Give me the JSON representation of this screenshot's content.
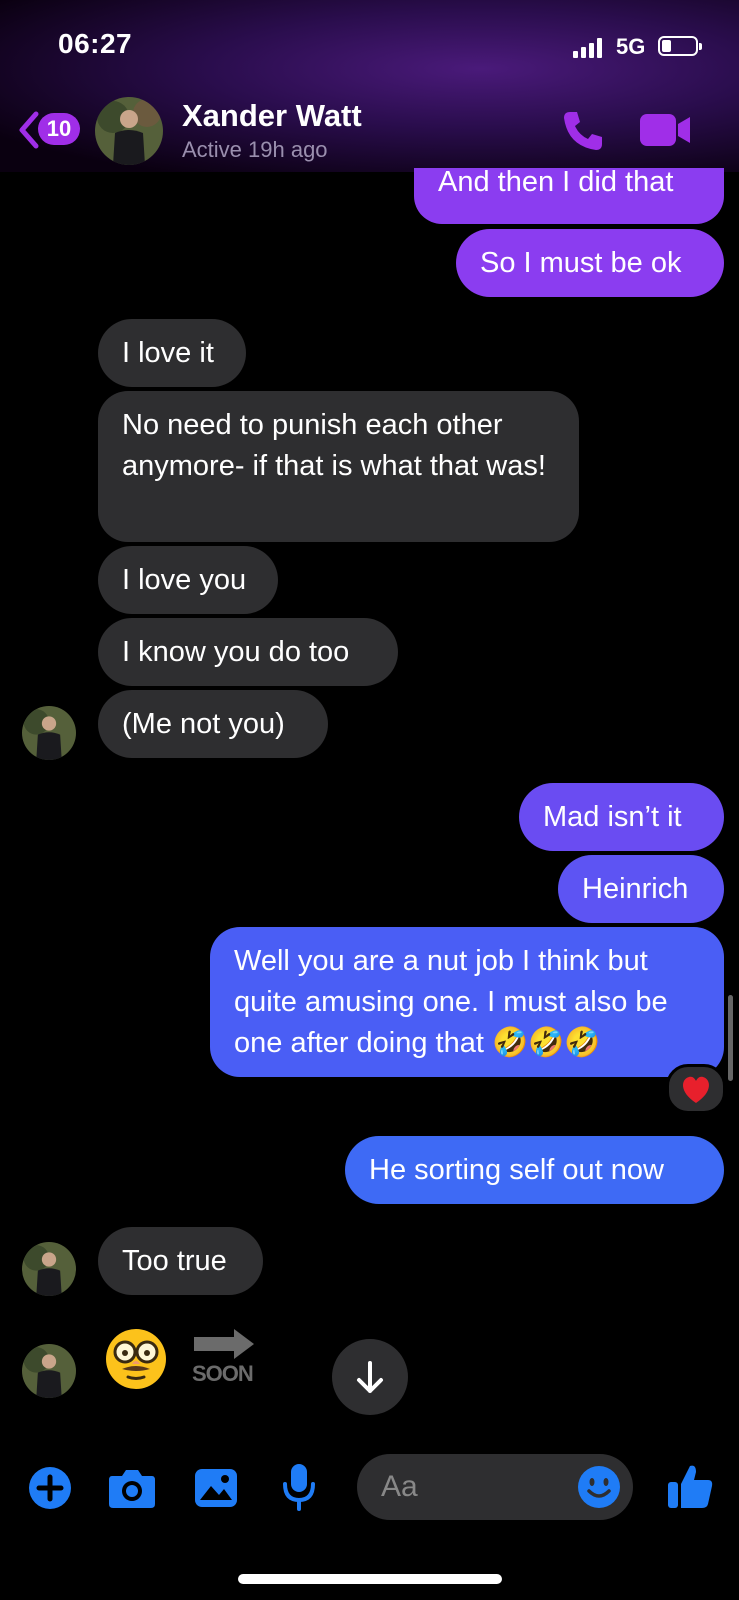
{
  "status_bar": {
    "time": "06:27",
    "network": "5G"
  },
  "header": {
    "back_badge_count": "10",
    "contact_name": "Xander Watt",
    "contact_status": "Active 19h ago"
  },
  "messages": [
    {
      "from": "me",
      "text": "And then I did that"
    },
    {
      "from": "me",
      "text": "So I must be ok"
    },
    {
      "from": "them",
      "text": "I love it"
    },
    {
      "from": "them",
      "text": "No need to punish each other anymore- if that is what that was!"
    },
    {
      "from": "them",
      "text": "I love you"
    },
    {
      "from": "them",
      "text": "I know you do too"
    },
    {
      "from": "them",
      "text": "(Me not you)"
    },
    {
      "from": "me",
      "text": "Mad isn’t it"
    },
    {
      "from": "me",
      "text": "Heinrich"
    },
    {
      "from": "me",
      "text": "Well you are a nut job I think but quite amusing one. I must also be one after doing that 🤣🤣🤣"
    },
    {
      "from": "me",
      "text": "He sorting self out now"
    },
    {
      "from": "them",
      "text": "Too true"
    }
  ],
  "reaction": "❤️",
  "last_message": {
    "emoji": "🥸",
    "badge": "SOON"
  },
  "composer": {
    "placeholder": "Aa"
  },
  "colors": {
    "outgoing_purple": "#8b3df0",
    "outgoing_blue": "#4a5ef5",
    "incoming": "#2e2e30",
    "header_accent": "#a02ee8",
    "composer_blue": "#1f7cf6"
  },
  "icons": [
    "back-chevron-icon",
    "phone-icon",
    "video-camera-icon",
    "heart-icon",
    "arrow-down-icon",
    "plus-icon",
    "camera-icon",
    "gallery-icon",
    "microphone-icon",
    "smiley-icon",
    "thumbs-up-icon"
  ]
}
